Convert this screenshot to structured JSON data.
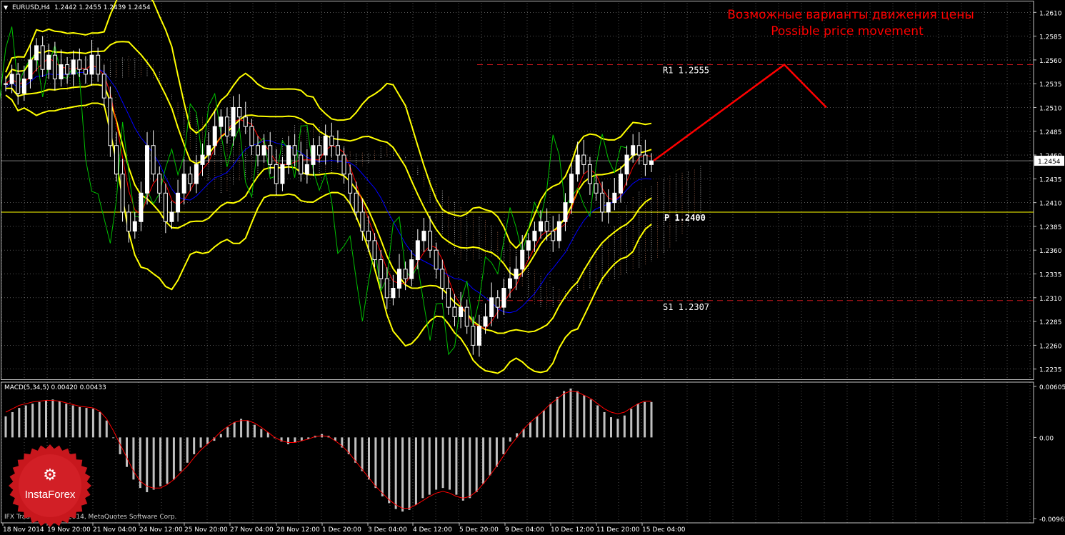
{
  "header": {
    "symbol_label": "EURUSD,H4",
    "ohlc": "1.2442 1.2455 1.2439 1.2454"
  },
  "macd_header": "MACD(5,34,5) 0.00420 0.00433",
  "annotation": {
    "line1": "Возможные варианты движения цены",
    "line2": "Possible price movement"
  },
  "levels": {
    "r1": "R1  1.2555",
    "p": "P  1.2400",
    "s1": "S1  1.2307"
  },
  "current_price": "1.2454",
  "footer": "IFX Trader, © 2001-2014, MetaQuotes Software Corp.",
  "logo_text": "InstaForex",
  "colors": {
    "background": "#000000",
    "grid": "#c0c0c0",
    "bullish": "#ffffff",
    "bearish": "#ffffff",
    "bollinger": "#ffff00",
    "tenkan": "#ff0000",
    "kijun": "#0000ff",
    "chikou": "#00c000",
    "forecast": "#ff0000",
    "pivot": "#ffff00",
    "annotation": "#ff0000",
    "macd_hist": "#c0c0c0",
    "macd_signal": "#ff0000"
  },
  "chart_data": [
    {
      "type": "candlestick",
      "title": "EURUSD,H4",
      "ylim": [
        1.2225,
        1.262
      ],
      "y_ticks": [
        "1.2610",
        "1.2585",
        "1.2560",
        "1.2535",
        "1.2510",
        "1.2485",
        "1.2460",
        "1.2435",
        "1.2410",
        "1.2385",
        "1.2360",
        "1.2335",
        "1.2310",
        "1.2285",
        "1.2260",
        "1.2235"
      ],
      "x_ticks": [
        "18 Nov 2014",
        "19 Nov 20:00",
        "21 Nov 04:00",
        "24 Nov 12:00",
        "25 Nov 20:00",
        "27 Nov 04:00",
        "28 Nov 12:00",
        "1 Dec 20:00",
        "3 Dec 04:00",
        "4 Dec 12:00",
        "5 Dec 20:00",
        "9 Dec 04:00",
        "10 Dec 12:00",
        "11 Dec 20:00",
        "15 Dec 04:00"
      ],
      "close": [
        1.2535,
        1.2545,
        1.2525,
        1.254,
        1.256,
        1.2575,
        1.255,
        1.2565,
        1.254,
        1.2555,
        1.2545,
        1.256,
        1.255,
        1.2545,
        1.2565,
        1.2545,
        1.252,
        1.247,
        1.244,
        1.24,
        1.238,
        1.239,
        1.242,
        1.247,
        1.244,
        1.242,
        1.239,
        1.24,
        1.242,
        1.244,
        1.243,
        1.245,
        1.246,
        1.247,
        1.249,
        1.25,
        1.248,
        1.251,
        1.25,
        1.249,
        1.247,
        1.246,
        1.247,
        1.245,
        1.243,
        1.245,
        1.247,
        1.246,
        1.244,
        1.245,
        1.247,
        1.246,
        1.248,
        1.247,
        1.246,
        1.244,
        1.242,
        1.24,
        1.238,
        1.237,
        1.235,
        1.233,
        1.231,
        1.232,
        1.234,
        1.233,
        1.235,
        1.237,
        1.238,
        1.236,
        1.234,
        1.232,
        1.23,
        1.229,
        1.23,
        1.228,
        1.226,
        1.228,
        1.229,
        1.231,
        1.23,
        1.232,
        1.233,
        1.234,
        1.236,
        1.237,
        1.238,
        1.239,
        1.238,
        1.237,
        1.239,
        1.241,
        1.244,
        1.246,
        1.245,
        1.243,
        1.242,
        1.24,
        1.241,
        1.242,
        1.244,
        1.246,
        1.247,
        1.246,
        1.245,
        1.2454
      ],
      "series": [
        {
          "name": "R1",
          "value": 1.2555
        },
        {
          "name": "P",
          "value": 1.24
        },
        {
          "name": "S1",
          "value": 1.2307
        }
      ],
      "forecast": [
        1.2454,
        1.2555,
        1.251
      ]
    },
    {
      "type": "bar",
      "title": "MACD(5,34,5)",
      "ylim": [
        -0.00963,
        0.00605
      ],
      "y_ticks": [
        "0.00605",
        "0.00",
        "-0.00963"
      ],
      "macd_values": [
        0.0025,
        0.003,
        0.0035,
        0.0038,
        0.004,
        0.0042,
        0.0044,
        0.0045,
        0.0043,
        0.004,
        0.0038,
        0.0036,
        0.0035,
        0.0034,
        0.003,
        0.002,
        0.0,
        -0.002,
        -0.0035,
        -0.005,
        -0.006,
        -0.0065,
        -0.0062,
        -0.0058,
        -0.0055,
        -0.005,
        -0.004,
        -0.003,
        -0.002,
        -0.0012,
        -0.0008,
        -0.0004,
        0.0004,
        0.0012,
        0.0018,
        0.0022,
        0.002,
        0.0015,
        0.001,
        0.0006,
        0.0,
        -0.0005,
        -0.0008,
        -0.0006,
        -0.0004,
        -0.0002,
        0.0002,
        0.0004,
        0.0002,
        -0.0004,
        -0.0012,
        -0.002,
        -0.003,
        -0.004,
        -0.005,
        -0.006,
        -0.007,
        -0.0078,
        -0.0085,
        -0.0088,
        -0.0086,
        -0.008,
        -0.0072,
        -0.0068,
        -0.0062,
        -0.006,
        -0.0062,
        -0.0068,
        -0.0075,
        -0.0072,
        -0.0065,
        -0.0055,
        -0.0045,
        -0.0035,
        -0.002,
        -0.0005,
        0.0005,
        0.001,
        0.0018,
        0.0025,
        0.0032,
        0.004,
        0.0048,
        0.0055,
        0.0058,
        0.0055,
        0.005,
        0.0045,
        0.0038,
        0.003,
        0.0024,
        0.0022,
        0.0026,
        0.0034,
        0.004,
        0.0042,
        0.0042
      ],
      "signal_values": [
        0.003,
        0.0034,
        0.0038,
        0.004,
        0.0042,
        0.0043,
        0.0044,
        0.0044,
        0.0043,
        0.0041,
        0.0039,
        0.0037,
        0.0036,
        0.0035,
        0.0031,
        0.0022,
        0.0008,
        -0.0008,
        -0.0024,
        -0.004,
        -0.0052,
        -0.0058,
        -0.006,
        -0.006,
        -0.0056,
        -0.005,
        -0.0042,
        -0.0034,
        -0.0024,
        -0.0015,
        -0.0008,
        -0.0001,
        0.0007,
        0.0013,
        0.0018,
        0.002,
        0.002,
        0.0017,
        0.0012,
        0.0006,
        0.0,
        -0.0004,
        -0.0006,
        -0.0006,
        -0.0004,
        -0.0002,
        0.0001,
        0.0002,
        0.0001,
        -0.0004,
        -0.001,
        -0.0018,
        -0.0028,
        -0.0038,
        -0.0048,
        -0.0058,
        -0.0066,
        -0.0074,
        -0.008,
        -0.0084,
        -0.0084,
        -0.008,
        -0.0075,
        -0.007,
        -0.0066,
        -0.0064,
        -0.0066,
        -0.007,
        -0.0072,
        -0.007,
        -0.0064,
        -0.0055,
        -0.0045,
        -0.0034,
        -0.0022,
        -0.001,
        0.0,
        0.001,
        0.0018,
        0.0025,
        0.0032,
        0.004,
        0.0046,
        0.0052,
        0.0055,
        0.0054,
        0.005,
        0.0046,
        0.004,
        0.0034,
        0.003,
        0.0028,
        0.003,
        0.0035,
        0.004,
        0.0043,
        0.0043
      ]
    }
  ]
}
